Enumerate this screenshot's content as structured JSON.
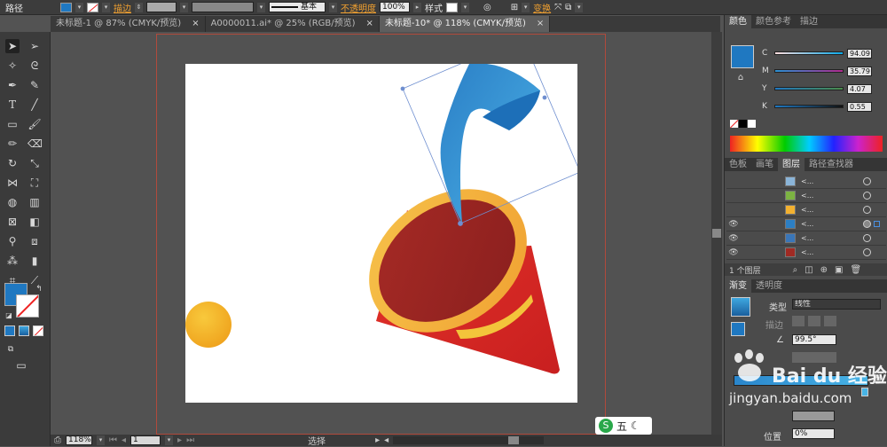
{
  "control_bar": {
    "selection_label": "路径",
    "stroke_label": "描边",
    "stroke_profile": "基本",
    "opacity_label": "不透明度",
    "opacity_value": "100%",
    "style_label": "样式",
    "transform_label": "变换"
  },
  "document_tabs": [
    {
      "label": "未标题-1 @ 87% (CMYK/预览)",
      "close": "×"
    },
    {
      "label": "A0000011.ai* @ 25% (RGB/预览)",
      "close": "×"
    },
    {
      "label": "未标题-10* @ 118% (CMYK/预览)",
      "close": "×"
    }
  ],
  "status_bar": {
    "zoom": "118%",
    "artboard_number": "1",
    "mode_label": "选择"
  },
  "color_panel": {
    "tabs": [
      "颜色",
      "颜色参考",
      "描边"
    ],
    "channels": [
      {
        "key": "C",
        "value": "94.09"
      },
      {
        "key": "M",
        "value": "35.79"
      },
      {
        "key": "Y",
        "value": "4.07"
      },
      {
        "key": "K",
        "value": "0.55"
      }
    ],
    "fill_color": "#1f78c1"
  },
  "layers_panel": {
    "tabs": [
      "色板",
      "画笔",
      "图层",
      "路径查找器"
    ],
    "rows": [
      {
        "name": "<...",
        "visible": false,
        "thumb": "#8ab4d8"
      },
      {
        "name": "<...",
        "visible": false,
        "thumb": "#7cb342"
      },
      {
        "name": "<...",
        "visible": false,
        "thumb": "#f3b130"
      },
      {
        "name": "<...",
        "visible": true,
        "thumb": "#2c7fc4"
      },
      {
        "name": "<...",
        "visible": true,
        "thumb": "#3a76b8"
      },
      {
        "name": "<...",
        "visible": true,
        "thumb": "#a02a23"
      }
    ],
    "layer_count": "1 个图层"
  },
  "gradient_panel": {
    "tabs": [
      "渐变",
      "透明度"
    ],
    "type_label": "类型",
    "type_value": "线性",
    "stroke_label": "描边",
    "angle_value": "99.5°",
    "position_label": "位置",
    "position_value": "0%"
  },
  "watermark": {
    "brand": "Bai du 经验",
    "url": "jingyan.baidu.com"
  },
  "ime_indicator": "五"
}
